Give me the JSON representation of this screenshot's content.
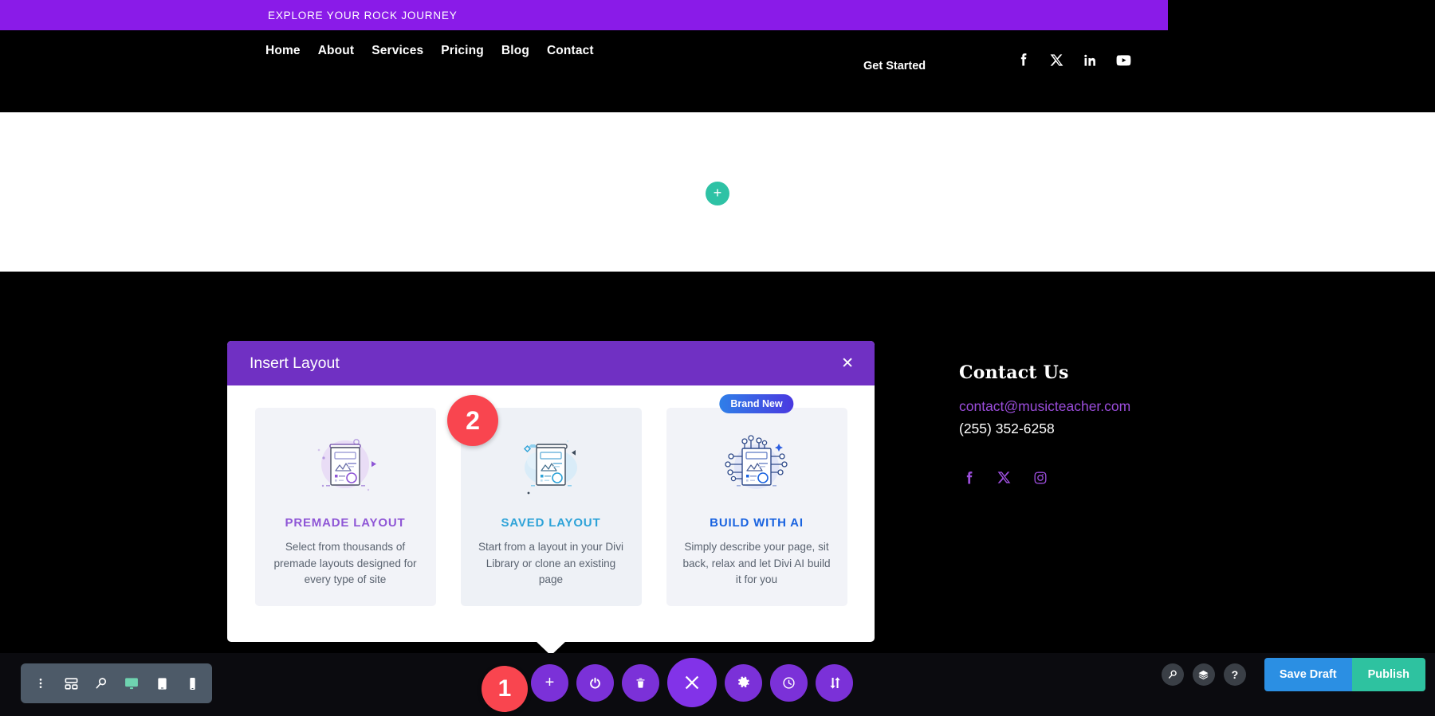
{
  "announcement": {
    "text": "EXPLORE YOUR ROCK JOURNEY"
  },
  "nav": {
    "links": [
      {
        "label": "Home"
      },
      {
        "label": "About"
      },
      {
        "label": "Services"
      },
      {
        "label": "Pricing"
      },
      {
        "label": "Blog"
      },
      {
        "label": "Contact"
      }
    ],
    "cta_label": "Get Started",
    "social": [
      {
        "name": "facebook-icon"
      },
      {
        "name": "x-twitter-icon"
      },
      {
        "name": "linkedin-icon"
      },
      {
        "name": "youtube-icon"
      }
    ]
  },
  "canvas": {
    "add_section_icon": "plus-icon",
    "add_section_glyph": "+"
  },
  "contact": {
    "title": "Contact Us",
    "email": "contact@musicteacher.com",
    "phone": "(255) 352-6258",
    "social": [
      {
        "name": "facebook-icon"
      },
      {
        "name": "x-twitter-icon"
      },
      {
        "name": "instagram-icon"
      }
    ]
  },
  "modal": {
    "title": "Insert Layout",
    "close_glyph": "✕",
    "options": [
      {
        "id": "premade-layout",
        "title": "PREMADE LAYOUT",
        "description": "Select from thousands of premade layouts designed for every type of site",
        "badge": null,
        "accent": "#8f56d6"
      },
      {
        "id": "saved-layout",
        "title": "SAVED LAYOUT",
        "description": "Start from a layout in your Divi Library or clone an existing page",
        "badge": null,
        "accent": "#2ea3d8"
      },
      {
        "id": "build-with-ai",
        "title": "BUILD WITH AI",
        "description": "Simply describe your page, sit back, relax and let Divi AI build it for you",
        "badge": "Brand New",
        "accent": "#1a63e0"
      }
    ]
  },
  "steps": [
    {
      "number": "1"
    },
    {
      "number": "2"
    }
  ],
  "toolbar": {
    "left_tools": [
      {
        "name": "more-options-icon"
      },
      {
        "name": "wireframe-view-icon"
      },
      {
        "name": "zoom-out-view-icon"
      },
      {
        "name": "desktop-view-icon"
      },
      {
        "name": "tablet-view-icon"
      },
      {
        "name": "phone-view-icon"
      }
    ],
    "center_tools": [
      {
        "name": "add-section-icon",
        "glyph": "+"
      },
      {
        "name": "power-toggle-icon",
        "glyph": ""
      },
      {
        "name": "trash-icon",
        "glyph": ""
      },
      {
        "name": "close-builder-icon",
        "glyph": ""
      },
      {
        "name": "settings-gear-icon",
        "glyph": ""
      },
      {
        "name": "history-clock-icon",
        "glyph": ""
      },
      {
        "name": "portability-icon",
        "glyph": ""
      }
    ],
    "right_tools": [
      {
        "name": "search-icon"
      },
      {
        "name": "layers-icon"
      },
      {
        "name": "help-icon",
        "glyph": "?"
      }
    ],
    "save_draft_label": "Save Draft",
    "publish_label": "Publish"
  },
  "colors": {
    "announce_purple": "#8a1be8",
    "modal_purple": "#7030c3",
    "step_red": "#f9454f",
    "teal": "#2ec2a5",
    "save_blue": "#2b8fe3",
    "publish_green": "#2ec2a0",
    "builder_purple": "#7b31d8",
    "contact_accent": "#9b4ddb"
  }
}
